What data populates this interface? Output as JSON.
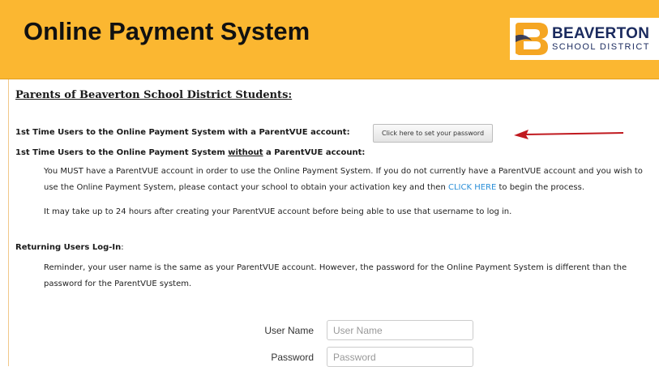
{
  "header": {
    "title": "Online Payment System",
    "logo": {
      "name": "BEAVERTON",
      "subtitle": "SCHOOL DISTRICT",
      "brand_navy": "#1a2a5e",
      "brand_orange": "#f5a623"
    },
    "background_color": "#fbb731"
  },
  "main": {
    "heading": "Parents of Beaverton School District Students:",
    "first_time_with": {
      "label": "1st Time Users to the Online Payment System with a ParentVUE account:",
      "button_label": "Click here to set your password",
      "arrow_color": "#c0191f"
    },
    "first_time_without": {
      "label_pre": "1st Time Users to the Online Payment System ",
      "label_underlined": "without",
      "label_post": " a ParentVUE account:",
      "para1_line1": "You MUST have a ParentVUE account in order to use the Online Payment System.  If you do not currently have a ParentVUE account and you wish to",
      "para1_line2_pre": "use the Online Payment System, please contact your school to obtain your activation key and then ",
      "para1_link": "CLICK HERE",
      "para1_line2_post": " to begin the process.",
      "para2": "It may take up to 24 hours after creating your ParentVUE account before being able to use that username to log in."
    },
    "returning": {
      "label_bold": "Returning Users Log-In",
      "label_colon": ":",
      "reminder_line1": "Reminder, your user name is the same as your ParentVUE account.  However, the password for the Online Payment System is different than the",
      "reminder_line2": "password for the ParentVUE system."
    },
    "login_form": {
      "username_label": "User Name",
      "username_placeholder": "User Name",
      "username_value": "",
      "password_label": "Password",
      "password_placeholder": "Password",
      "password_value": ""
    },
    "link_color": "#2a8fd8"
  }
}
